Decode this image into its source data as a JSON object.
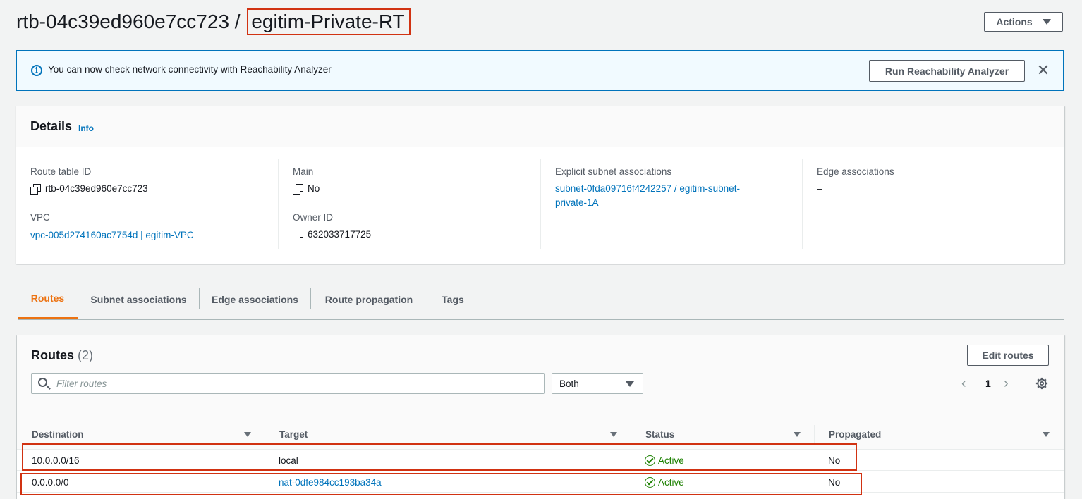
{
  "header": {
    "route_table_id": "rtb-04c39ed960e7cc723",
    "separator": "/",
    "name": "egitim-Private-RT",
    "actions_label": "Actions"
  },
  "flashbar": {
    "message": "You can now check network connectivity with Reachability Analyzer",
    "button_label": "Run Reachability Analyzer",
    "close_glyph": "✕"
  },
  "details": {
    "title": "Details",
    "info_link": "Info",
    "fields": {
      "route_table_id_label": "Route table ID",
      "route_table_id_value": "rtb-04c39ed960e7cc723",
      "vpc_label": "VPC",
      "vpc_value": "vpc-005d274160ac7754d | egitim-VPC",
      "main_label": "Main",
      "main_value": "No",
      "owner_label": "Owner ID",
      "owner_value": "632033717725",
      "explicit_label": "Explicit subnet associations",
      "explicit_value_line1": "subnet-0fda09716f4242257 / egitim-subnet-",
      "explicit_value_line2": "private-1A",
      "edge_label": "Edge associations",
      "edge_value": "–"
    }
  },
  "tabs": [
    {
      "label": "Routes",
      "active": true
    },
    {
      "label": "Subnet associations",
      "active": false
    },
    {
      "label": "Edge associations",
      "active": false
    },
    {
      "label": "Route propagation",
      "active": false
    },
    {
      "label": "Tags",
      "active": false
    }
  ],
  "routes": {
    "title": "Routes",
    "count": "(2)",
    "edit_label": "Edit routes",
    "filter_placeholder": "Filter routes",
    "select_value": "Both",
    "pager": {
      "prev": "‹",
      "page": "1",
      "next": "›"
    },
    "columns": [
      "Destination",
      "Target",
      "Status",
      "Propagated"
    ],
    "rows": [
      {
        "destination": "10.0.0.0/16",
        "target": "local",
        "target_is_link": false,
        "status": "Active",
        "propagated": "No"
      },
      {
        "destination": "0.0.0.0/0",
        "target": "nat-0dfe984cc193ba34a",
        "target_is_link": true,
        "status": "Active",
        "propagated": "No"
      }
    ]
  },
  "colors": {
    "accent": "#ec7211",
    "link": "#0073bb",
    "success": "#1d8102",
    "highlight": "#d13212"
  }
}
